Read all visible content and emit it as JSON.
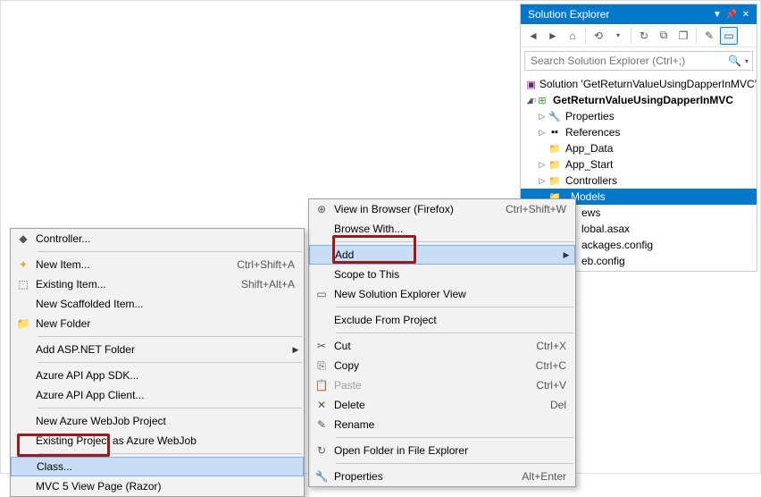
{
  "solution_explorer": {
    "title": "Solution Explorer",
    "search_placeholder": "Search Solution Explorer (Ctrl+;)",
    "tree": {
      "solution_label": "Solution 'GetReturnValueUsingDapperInMVC'",
      "project_label": "GetReturnValueUsingDapperInMVC",
      "properties": "Properties",
      "references": "References",
      "app_data": "App_Data",
      "app_start": "App_Start",
      "controllers": "Controllers",
      "models": "Models",
      "views": "ews",
      "global_asax": "lobal.asax",
      "packages_config": "ackages.config",
      "web_config": "eb.config"
    }
  },
  "menu_primary": {
    "view_in_browser": "View in Browser (Firefox)",
    "view_in_browser_shortcut": "Ctrl+Shift+W",
    "browse_with": "Browse With...",
    "add": "Add",
    "scope": "Scope to This",
    "new_solution_explorer": "New Solution Explorer View",
    "exclude": "Exclude From Project",
    "cut": "Cut",
    "cut_shortcut": "Ctrl+X",
    "copy": "Copy",
    "copy_shortcut": "Ctrl+C",
    "paste": "Paste",
    "paste_shortcut": "Ctrl+V",
    "delete": "Delete",
    "delete_shortcut": "Del",
    "rename": "Rename",
    "open_folder": "Open Folder in File Explorer",
    "properties": "Properties",
    "properties_shortcut": "Alt+Enter"
  },
  "menu_add": {
    "controller": "Controller...",
    "new_item": "New Item...",
    "new_item_shortcut": "Ctrl+Shift+A",
    "existing_item": "Existing Item...",
    "existing_item_shortcut": "Shift+Alt+A",
    "new_scaffolded": "New Scaffolded Item...",
    "new_folder": "New Folder",
    "add_aspnet_folder": "Add ASP.NET Folder",
    "azure_api_sdk": "Azure API App SDK...",
    "azure_api_client": "Azure API App Client...",
    "new_azure_webjob": "New Azure WebJob Project",
    "existing_as_webjob": "Existing Project as Azure WebJob",
    "class": "Class...",
    "mvc5_view": "MVC 5 View Page (Razor)"
  }
}
